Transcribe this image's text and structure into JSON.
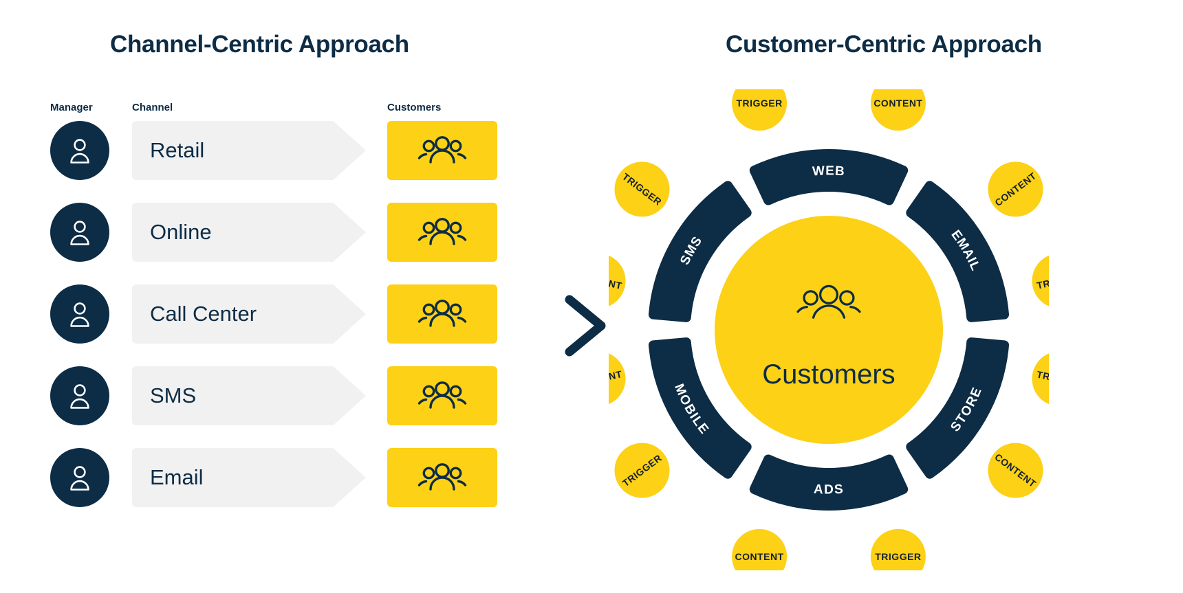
{
  "left_panel": {
    "title": "Channel-Centric Approach",
    "headers": {
      "manager": "Manager",
      "channel": "Channel",
      "customers": "Customers"
    },
    "rows": [
      {
        "manager_icon": "person-icon",
        "channel": "Retail",
        "customers_icon": "customer-group-icon"
      },
      {
        "manager_icon": "person-icon",
        "channel": "Online",
        "customers_icon": "customer-group-icon"
      },
      {
        "manager_icon": "person-icon",
        "channel": "Call Center",
        "customers_icon": "customer-group-icon"
      },
      {
        "manager_icon": "person-icon",
        "channel": "SMS",
        "customers_icon": "customer-group-icon"
      },
      {
        "manager_icon": "person-icon",
        "channel": "Email",
        "customers_icon": "customer-group-icon"
      }
    ]
  },
  "divider": {
    "icon": "chevron-right-icon"
  },
  "right_panel": {
    "title": "Customer-Centric Approach",
    "center": {
      "label": "Customers",
      "icon": "customer-group-icon"
    },
    "channel_arcs": [
      {
        "label": "WEB",
        "position": "top"
      },
      {
        "label": "EMAIL",
        "position": "upper-right"
      },
      {
        "label": "STORE",
        "position": "lower-right"
      },
      {
        "label": "ADS",
        "position": "bottom"
      },
      {
        "label": "MOBILE",
        "position": "lower-left"
      },
      {
        "label": "SMS",
        "position": "upper-left"
      }
    ],
    "bubbles": [
      {
        "label": "TRIGGER",
        "position": "top-left"
      },
      {
        "label": "CONTENT",
        "position": "top-right"
      },
      {
        "label": "CONTENT",
        "position": "upper-right-outer"
      },
      {
        "label": "TRIGGER",
        "position": "right-upper-outer"
      },
      {
        "label": "TRIGGER",
        "position": "right-lower-outer"
      },
      {
        "label": "CONTENT",
        "position": "lower-right-outer"
      },
      {
        "label": "TRIGGER",
        "position": "bottom-left"
      },
      {
        "label": "CONTENT",
        "position": "bottom-right"
      },
      {
        "label": "TRIGGER",
        "position": "lower-left-outer"
      },
      {
        "label": "CONTENT",
        "position": "left-lower-outer"
      },
      {
        "label": "CONTENT",
        "position": "left-upper-outer"
      },
      {
        "label": "TRIGGER",
        "position": "upper-left-outer"
      }
    ]
  },
  "colors": {
    "navy": "#0d2c45",
    "yellow": "#fcd116",
    "light_gray": "#f1f1f1",
    "background": "#ffffff",
    "bubble_text": "#16202b"
  }
}
